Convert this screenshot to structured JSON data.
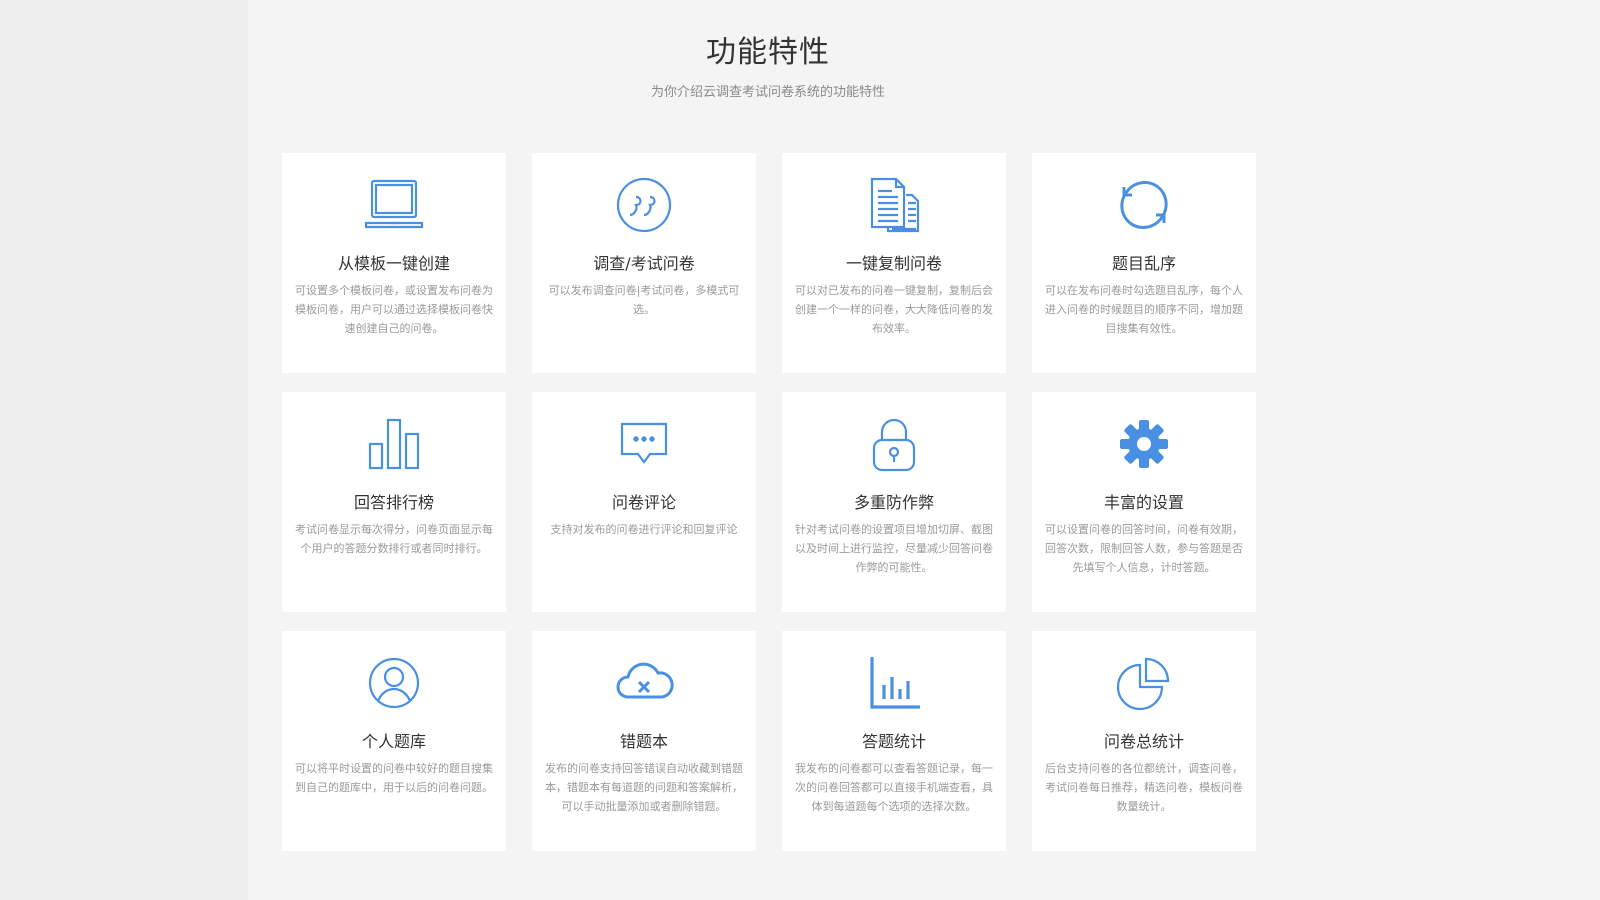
{
  "header": {
    "title": "功能特性",
    "subtitle": "为你介绍云调查考试问卷系统的功能特性"
  },
  "colors": {
    "accent": "#4a90e2",
    "card_bg": "#ffffff",
    "page_bg": "#f4f4f4"
  },
  "features": [
    {
      "icon": "laptop-icon",
      "title": "从模板一键创建",
      "desc": "可设置多个模板问卷，或设置发布问卷为模板问卷，用户可以通过选择模板问卷快速创建自己的问卷。"
    },
    {
      "icon": "quote-icon",
      "title": "调查/考试问卷",
      "desc": "可以发布调查问卷|考试问卷，多模式可选。"
    },
    {
      "icon": "document-copy-icon",
      "title": "一键复制问卷",
      "desc": "可以对已发布的问卷一键复制，复制后会创建一个一样的问卷，大大降低问卷的发布效率。"
    },
    {
      "icon": "refresh-icon",
      "title": "题目乱序",
      "desc": "可以在发布问卷时勾选题目乱序，每个人进入问卷的时候题目的顺序不同，增加题目搜集有效性。"
    },
    {
      "icon": "bar-chart-icon",
      "title": "回答排行榜",
      "desc": "考试问卷显示每次得分，问卷页面显示每个用户的答题分数排行或者同时排行。"
    },
    {
      "icon": "comment-icon",
      "title": "问卷评论",
      "desc": "支持对发布的问卷进行评论和回复评论"
    },
    {
      "icon": "lock-icon",
      "title": "多重防作弊",
      "desc": "针对考试问卷的设置项目增加切屏、截图以及时间上进行监控，尽量减少回答问卷作弊的可能性。"
    },
    {
      "icon": "gear-icon",
      "title": "丰富的设置",
      "desc": "可以设置问卷的回答时间，问卷有效期，回答次数，限制回答人数，参与答题是否先填写个人信息，计时答题。"
    },
    {
      "icon": "user-icon",
      "title": "个人题库",
      "desc": "可以将平时设置的问卷中较好的题目搜集到自己的题库中，用于以后的问卷问题。"
    },
    {
      "icon": "cloud-error-icon",
      "title": "错题本",
      "desc": "发布的问卷支持回答错误自动收藏到错题本，错题本有每道题的问题和答案解析，可以手动批量添加或者删除错题。"
    },
    {
      "icon": "statistics-icon",
      "title": "答题统计",
      "desc": "我发布的问卷都可以查看答题记录，每一次的问卷回答都可以直接手机端查看，具体到每道题每个选项的选择次数。"
    },
    {
      "icon": "pie-chart-icon",
      "title": "问卷总统计",
      "desc": "后台支持问卷的各位都统计，调查问卷，考试问卷每日推荐，精选问卷，模板问卷数量统计。"
    }
  ]
}
